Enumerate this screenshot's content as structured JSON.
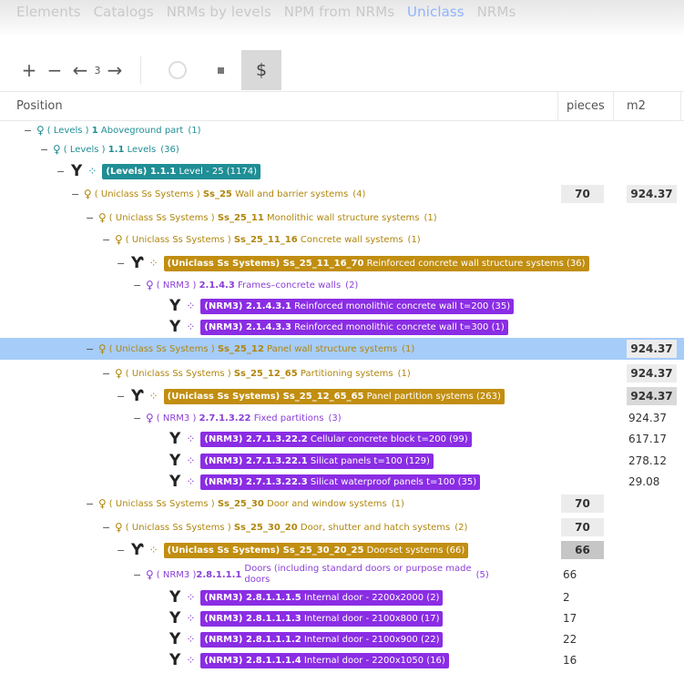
{
  "breadcrumb": {
    "items": [
      "Elements",
      "Catalogs",
      "NRMs by levels",
      "NPM from NRMs",
      "Uniclass",
      "NRMs"
    ],
    "active_index": 4
  },
  "toolbar": {
    "plus": "+",
    "minus": "−",
    "prev": "←",
    "level": "3",
    "next": "→",
    "dollar": "$"
  },
  "columns": {
    "position": "Position",
    "pieces": "pieces",
    "m2": "m2"
  },
  "rows": [
    {
      "g": "( Levels ) ",
      "code": "1",
      "name": " Aboveground part",
      "count": "(1)"
    },
    {
      "g": "( Levels ) ",
      "code": "1.1",
      "name": " Levels",
      "count": "(36)"
    },
    {
      "g": "(Levels) ",
      "code": "1.1.1",
      "name": " Level - 25",
      "count": "(1174)"
    },
    {
      "g": "( Uniclass Ss Systems ) ",
      "code": "Ss_25",
      "name": " Wall and barrier systems",
      "count": "(4)",
      "pieces": "70",
      "m2": "924.37"
    },
    {
      "g": "( Uniclass Ss Systems ) ",
      "code": "Ss_25_11",
      "name": " Monolithic wall structure systems",
      "count": "(1)"
    },
    {
      "g": "( Uniclass Ss Systems ) ",
      "code": "Ss_25_11_16",
      "name": " Concrete wall systems",
      "count": "(1)"
    },
    {
      "g": "(Uniclass Ss Systems) ",
      "code": "Ss_25_11_16_70",
      "name": " Reinforced concrete wall structure systems",
      "count": "(36)"
    },
    {
      "g": "( NRM3 ) ",
      "code": "2.1.4.3",
      "name": " Frames–concrete walls",
      "count": "(2)"
    },
    {
      "g": "(NRM3) ",
      "code": "2.1.4.3.1",
      "name": " Reinforced monolithic concrete wall t=200",
      "count": "(35)"
    },
    {
      "g": "(NRM3) ",
      "code": "2.1.4.3.3",
      "name": " Reinforced monolithic concrete wall t=300",
      "count": "(1)"
    },
    {
      "g": "( Uniclass Ss Systems ) ",
      "code": "Ss_25_12",
      "name": " Panel wall structure systems",
      "count": "(1)",
      "m2": "924.37"
    },
    {
      "g": "( Uniclass Ss Systems ) ",
      "code": "Ss_25_12_65",
      "name": " Partitioning systems",
      "count": "(1)",
      "m2": "924.37"
    },
    {
      "g": "(Uniclass Ss Systems) ",
      "code": "Ss_25_12_65_65",
      "name": " Panel partition systems",
      "count": "(263)",
      "m2": "924.37"
    },
    {
      "g": "( NRM3 ) ",
      "code": "2.7.1.3.22",
      "name": " Fixed partitions",
      "count": "(3)",
      "m2": "924.37"
    },
    {
      "g": "(NRM3) ",
      "code": "2.7.1.3.22.2",
      "name": " Cellular concrete block t=200",
      "count": "(99)",
      "m2": "617.17"
    },
    {
      "g": "(NRM3) ",
      "code": "2.7.1.3.22.1",
      "name": " Silicat panels t=100",
      "count": "(129)",
      "m2": "278.12"
    },
    {
      "g": "(NRM3) ",
      "code": "2.7.1.3.22.3",
      "name": " Silicat waterproof panels t=100",
      "count": "(35)",
      "m2": "29.08"
    },
    {
      "g": "( Uniclass Ss Systems ) ",
      "code": "Ss_25_30",
      "name": " Door and window systems",
      "count": "(1)",
      "pieces": "70"
    },
    {
      "g": "( Uniclass Ss Systems ) ",
      "code": "Ss_25_30_20",
      "name": " Door, shutter and hatch systems",
      "count": "(2)",
      "pieces": "70"
    },
    {
      "g": "(Uniclass Ss Systems) ",
      "code": "Ss_25_30_20_25",
      "name": " Doorset systems",
      "count": "(66)",
      "pieces": "66"
    },
    {
      "g": "( NRM3 ) ",
      "code": "2.8.1.1.1",
      "name": " Doors (including standard doors or purpose made doors",
      "name_line1": " Doors (including standard doors or purpose made",
      "name_line2": "doors",
      "count": "(5)",
      "pieces": "66"
    },
    {
      "g": "(NRM3) ",
      "code": "2.8.1.1.1.5",
      "name": " Internal door - 2200x2000",
      "count": "(2)",
      "pieces": "2"
    },
    {
      "g": "(NRM3) ",
      "code": "2.8.1.1.1.3",
      "name": " Internal door - 2100x800",
      "count": "(17)",
      "pieces": "17"
    },
    {
      "g": "(NRM3) ",
      "code": "2.8.1.1.1.2",
      "name": " Internal door - 2100x900",
      "count": "(22)",
      "pieces": "22"
    },
    {
      "g": "(NRM3) ",
      "code": "2.8.1.1.1.4",
      "name": " Internal door - 2200x1050",
      "count": "(16)",
      "pieces": "16"
    }
  ],
  "colors": {
    "teal": "#1f8e95",
    "gold": "#b0860c",
    "purple": "#8a3fd6",
    "selected": "#a6ccf9"
  },
  "icons": {
    "group": "group-icon",
    "fork": "fork-icon",
    "dots": "dots-icon"
  }
}
